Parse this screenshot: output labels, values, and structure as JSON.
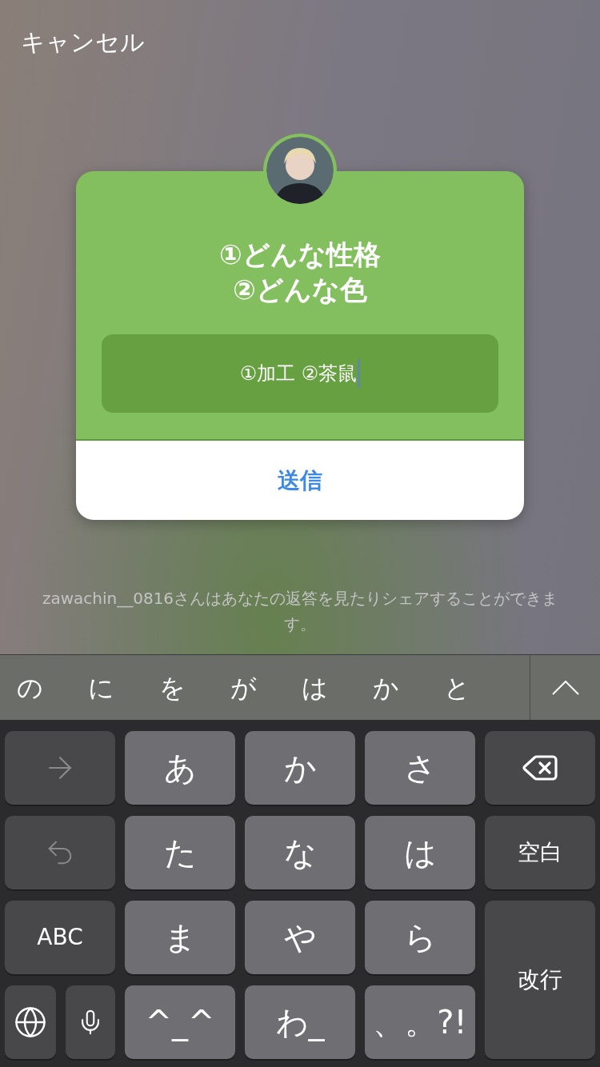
{
  "cancel": "キャンセル",
  "card": {
    "question": "①どんな性格\n②どんな色",
    "answer": "①加工 ②茶鼠",
    "send": "送信"
  },
  "notice": "zawachin__0816さんはあなたの返答を見たりシェアすることができます。",
  "suggestions": [
    "の",
    "に",
    "を",
    "が",
    "は",
    "か",
    "と"
  ],
  "keys": [
    {
      "kind": "arrow"
    },
    {
      "kind": "char",
      "label": "あ"
    },
    {
      "kind": "char",
      "label": "か"
    },
    {
      "kind": "char",
      "label": "さ"
    },
    {
      "kind": "delete"
    },
    {
      "kind": "undo"
    },
    {
      "kind": "char",
      "label": "た"
    },
    {
      "kind": "char",
      "label": "な"
    },
    {
      "kind": "char",
      "label": "は"
    },
    {
      "kind": "func",
      "label": "空白"
    },
    {
      "kind": "func",
      "label": "ABC"
    },
    {
      "kind": "char",
      "label": "ま"
    },
    {
      "kind": "char",
      "label": "や"
    },
    {
      "kind": "char",
      "label": "ら"
    },
    {
      "kind": "return",
      "label": "改行"
    },
    {
      "kind": "globe"
    },
    {
      "kind": "mic"
    },
    {
      "kind": "char",
      "label": "^_^"
    },
    {
      "kind": "char",
      "label": "わ_"
    },
    {
      "kind": "char",
      "label": "、。?!"
    }
  ]
}
